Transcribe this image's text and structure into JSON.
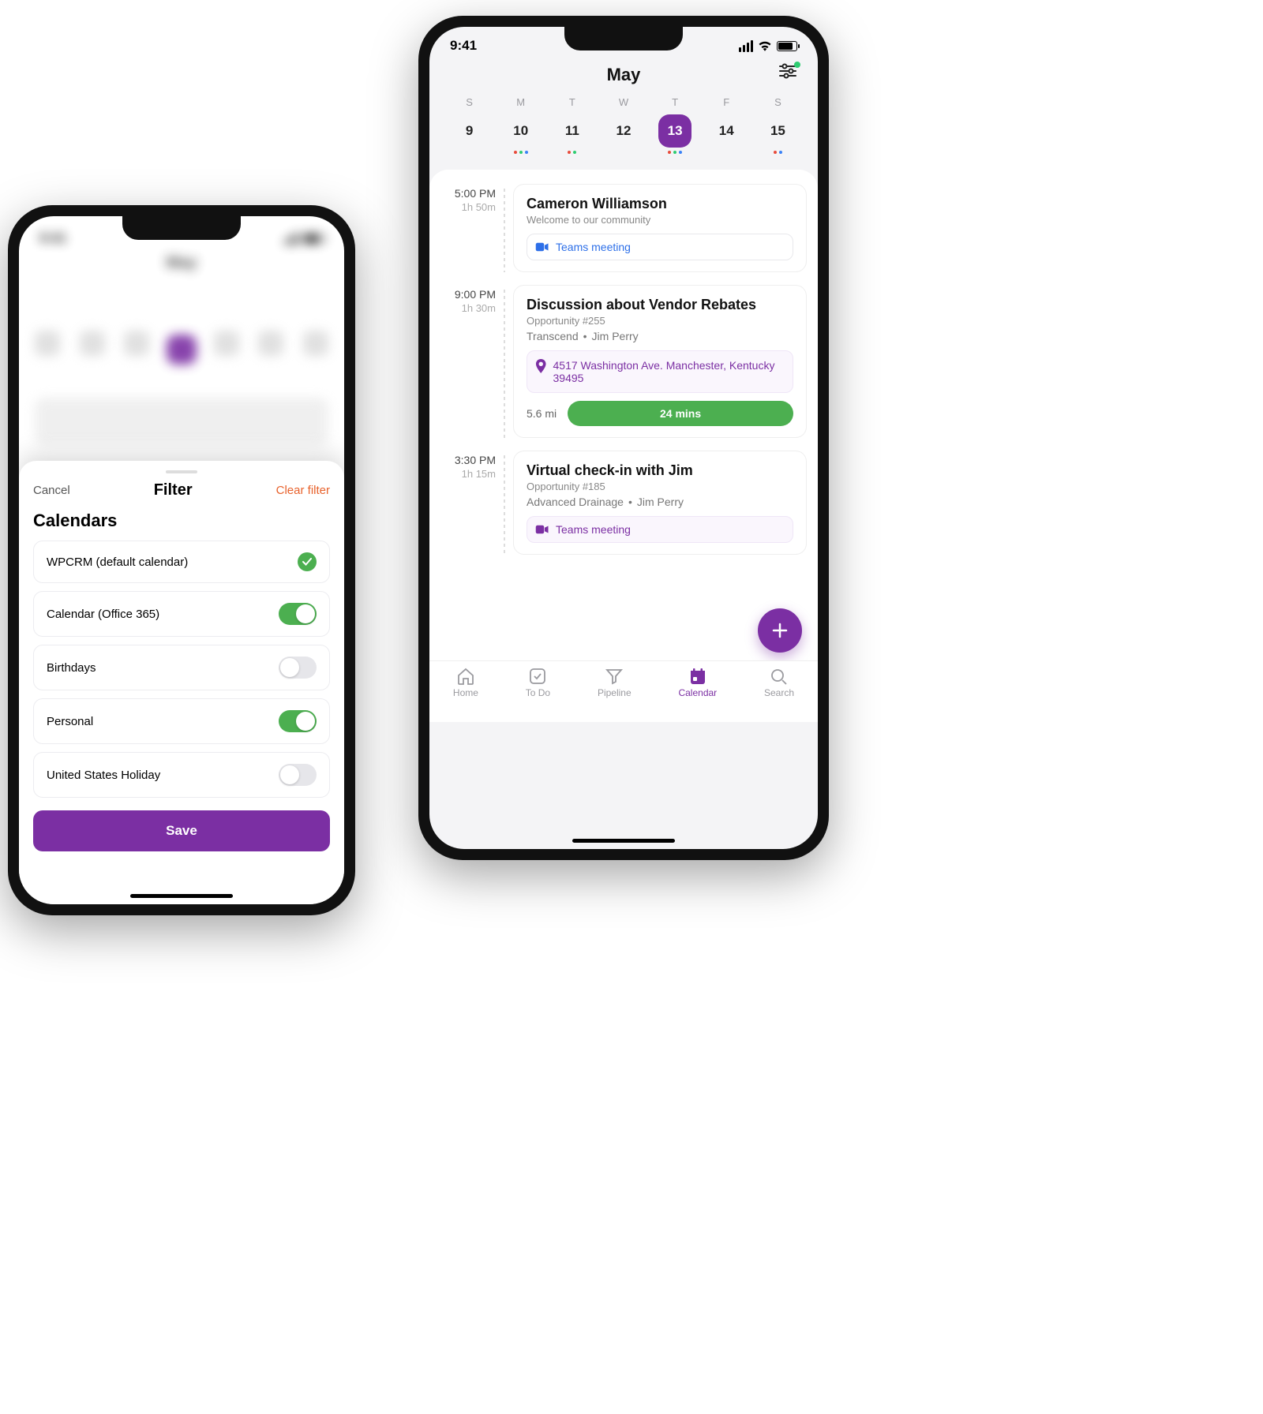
{
  "status_time": "9:41",
  "calendar": {
    "month": "May",
    "dow": [
      "S",
      "M",
      "T",
      "W",
      "T",
      "F",
      "S"
    ],
    "days": [
      {
        "n": "9",
        "dots": []
      },
      {
        "n": "10",
        "dots": [
          "red",
          "green",
          "blue"
        ]
      },
      {
        "n": "11",
        "dots": [
          "red",
          "green"
        ]
      },
      {
        "n": "12",
        "dots": []
      },
      {
        "n": "13",
        "dots": [
          "red",
          "green",
          "blue"
        ],
        "selected": true
      },
      {
        "n": "14",
        "dots": []
      },
      {
        "n": "15",
        "dots": [
          "red",
          "blue"
        ]
      }
    ]
  },
  "events": [
    {
      "time": "5:00 PM",
      "dur": "1h 50m",
      "title": "Cameron Williamson",
      "sub": "Welcome to our community",
      "teams": {
        "label": "Teams meeting",
        "style": "blue"
      }
    },
    {
      "time": "9:00 PM",
      "dur": "1h 30m",
      "title": "Discussion about Vendor Rebates",
      "sub": "Opportunity #255",
      "meta": {
        "a": "Transcend",
        "b": "Jim Perry"
      },
      "address": "4517 Washington Ave. Manchester, Kentucky 39495",
      "distance": "5.6 mi",
      "eta": "24 mins"
    },
    {
      "time": "3:30 PM",
      "dur": "1h 15m",
      "title": "Virtual check-in with Jim",
      "sub": "Opportunity #185",
      "meta": {
        "a": "Advanced Drainage",
        "b": "Jim Perry"
      },
      "teams": {
        "label": "Teams meeting",
        "style": "purple"
      }
    }
  ],
  "tabs": [
    {
      "label": "Home"
    },
    {
      "label": "To Do"
    },
    {
      "label": "Pipeline"
    },
    {
      "label": "Calendar",
      "active": true
    },
    {
      "label": "Search"
    }
  ],
  "filter_sheet": {
    "cancel": "Cancel",
    "title": "Filter",
    "clear": "Clear filter",
    "section": "Calendars",
    "items": [
      {
        "label": "WPCRM (default calendar)",
        "type": "check",
        "on": true
      },
      {
        "label": "Calendar (Office 365)",
        "type": "toggle",
        "on": true
      },
      {
        "label": "Birthdays",
        "type": "toggle",
        "on": false
      },
      {
        "label": "Personal",
        "type": "toggle",
        "on": true
      },
      {
        "label": "United States Holiday",
        "type": "toggle",
        "on": false
      }
    ],
    "save": "Save"
  }
}
